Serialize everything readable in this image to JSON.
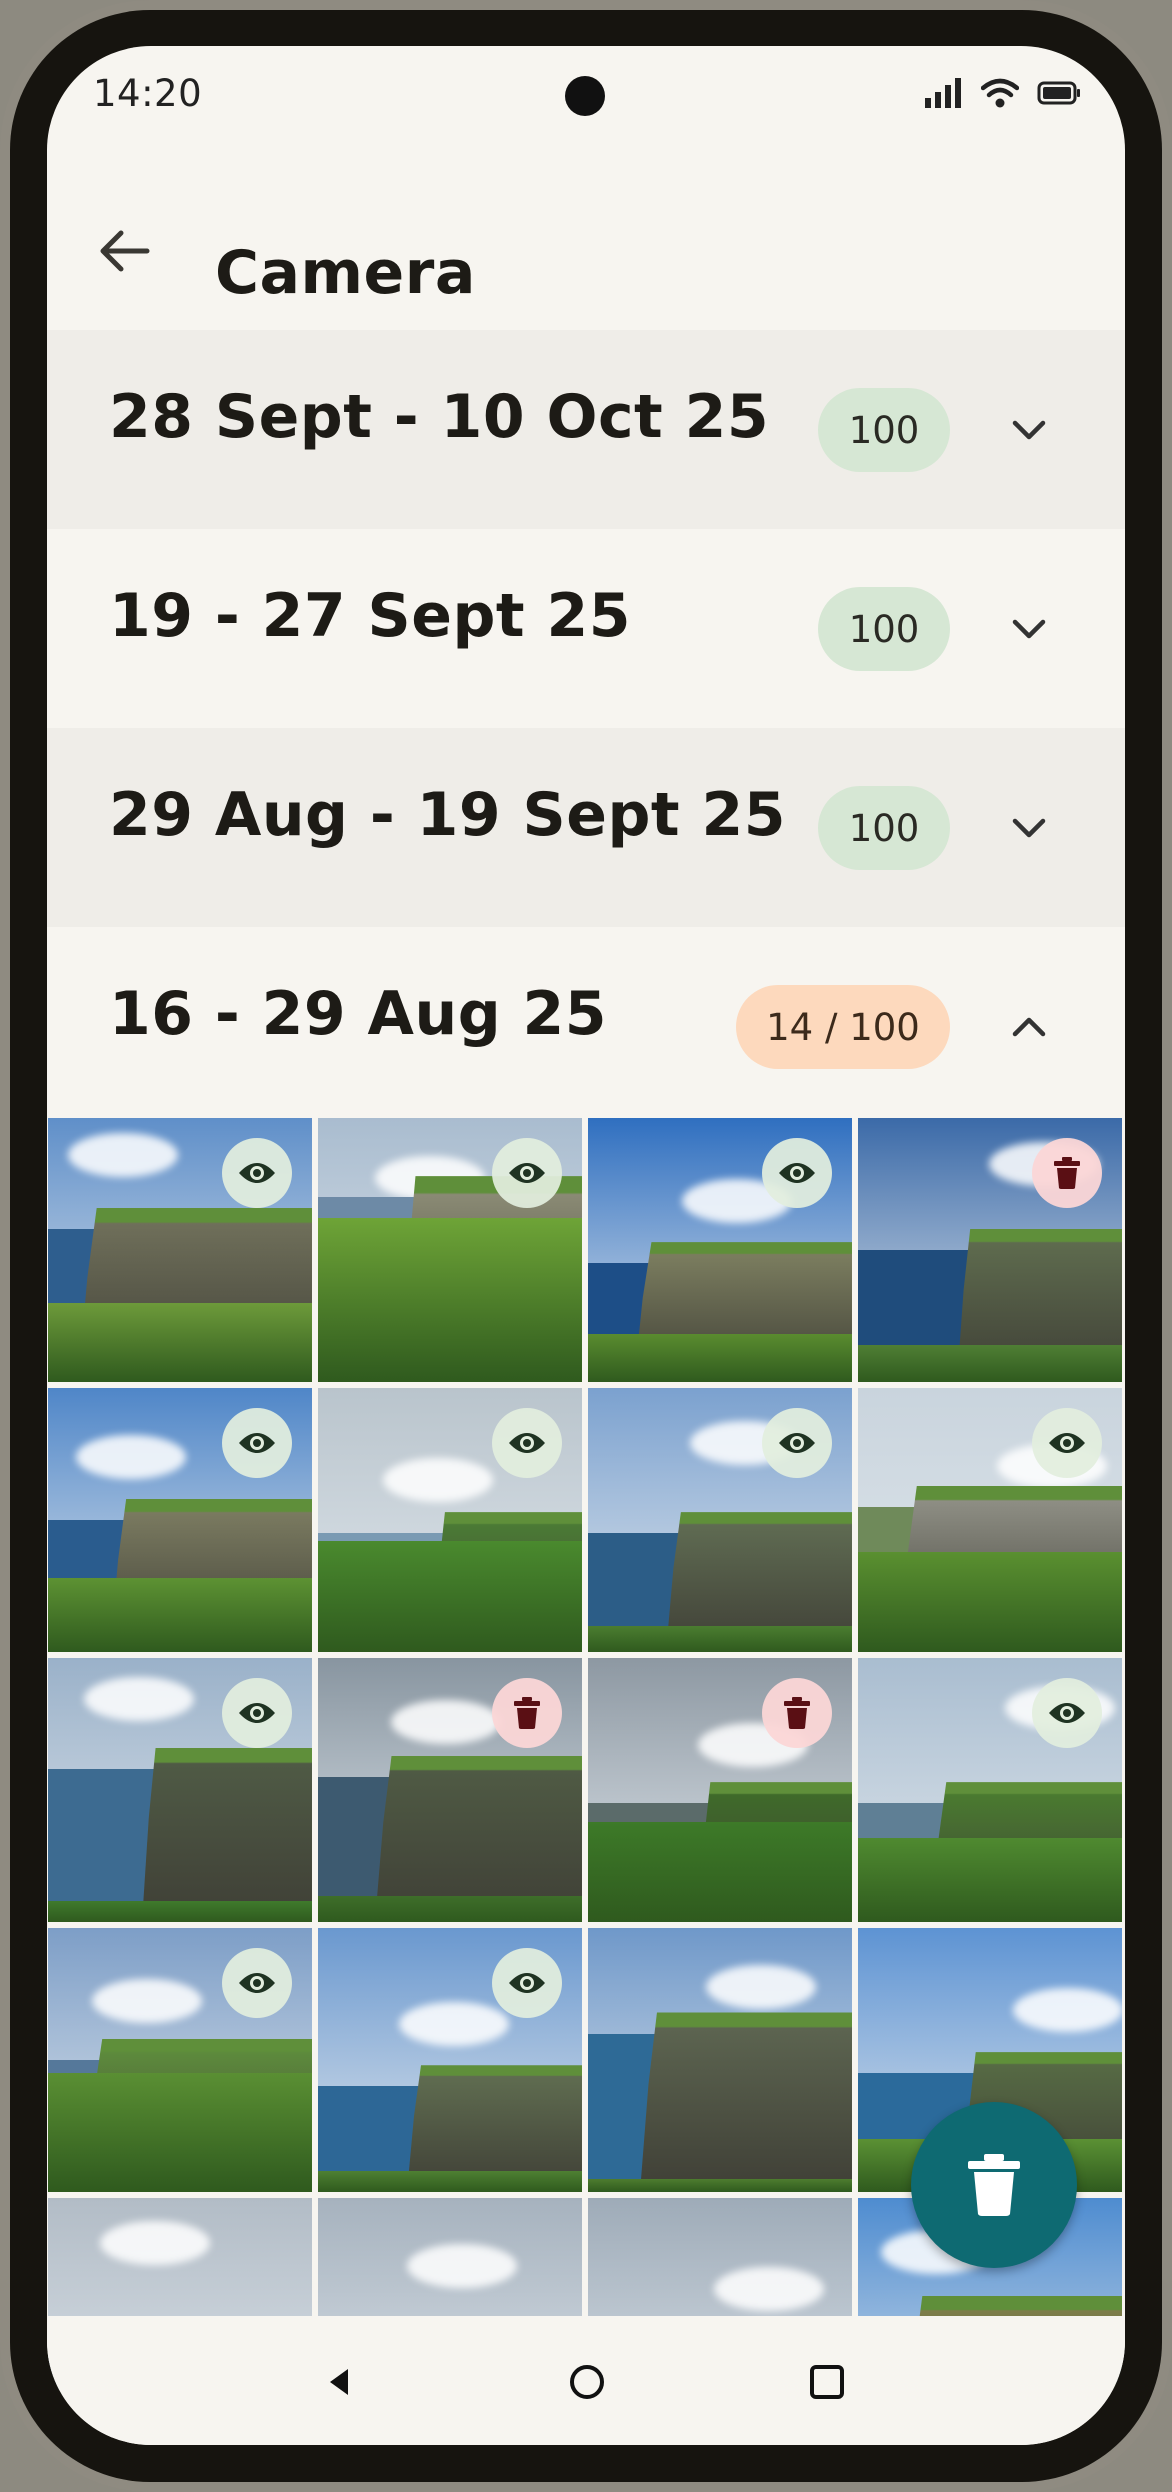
{
  "status_bar": {
    "time": "14:20"
  },
  "header": {
    "title": "Camera"
  },
  "groups": [
    {
      "label": "28 Sept - 10 Oct 25",
      "count": "100",
      "expanded": false
    },
    {
      "label": "19 - 27 Sept 25",
      "count": "100",
      "expanded": false
    },
    {
      "label": "29 Aug - 19 Sept 25",
      "count": "100",
      "expanded": false
    },
    {
      "label": "16 - 29 Aug 25",
      "count": "14 / 100",
      "expanded": true
    }
  ],
  "photos": [
    {
      "status": "keep"
    },
    {
      "status": "keep"
    },
    {
      "status": "keep"
    },
    {
      "status": "delete"
    },
    {
      "status": "keep"
    },
    {
      "status": "keep"
    },
    {
      "status": "keep"
    },
    {
      "status": "keep"
    },
    {
      "status": "keep"
    },
    {
      "status": "delete"
    },
    {
      "status": "delete"
    },
    {
      "status": "keep"
    },
    {
      "status": "keep"
    },
    {
      "status": "keep"
    },
    {
      "status": "none"
    },
    {
      "status": "none"
    },
    {
      "status": "none"
    },
    {
      "status": "none"
    },
    {
      "status": "none"
    },
    {
      "status": "none"
    }
  ],
  "icons": {
    "back": "arrow-left-icon",
    "keep": "eye-icon",
    "delete": "trash-icon",
    "fab": "trash-icon",
    "collapsed": "chevron-down-icon",
    "expanded": "chevron-up-icon"
  },
  "colors": {
    "background": "#f7f5f0",
    "badge_green": "#d6e7d4",
    "badge_orange": "#fdd9bd",
    "fab": "#0e6a72",
    "delete_icon": "#5a0f14",
    "keep_icon": "#1f3322"
  }
}
